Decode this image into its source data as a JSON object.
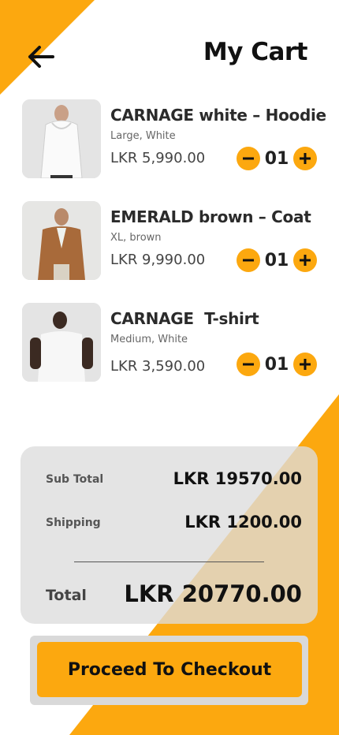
{
  "header": {
    "title": "My Cart",
    "back_icon": "arrow-left-icon"
  },
  "colors": {
    "accent": "#FCA80F",
    "summary_bg": "#DCDCDC",
    "button_frame": "#D9D9D9"
  },
  "cart": {
    "items": [
      {
        "name": "CARNAGE white – Hoodie",
        "variant": "Large, White",
        "price": "LKR 5,990.00",
        "quantity": "01",
        "image": "white hoodie model photo"
      },
      {
        "name": "EMERALD brown – Coat",
        "variant": "XL, brown",
        "price": "LKR 9,990.00",
        "quantity": "01",
        "image": "brown coat model photo"
      },
      {
        "name": "CARNAGE  T-shirt",
        "variant": "Medium, White",
        "price": "LKR 3,590.00",
        "quantity": "01",
        "image": "white t-shirt model photo"
      }
    ]
  },
  "summary": {
    "subtotal_label": "Sub Total",
    "subtotal_value": "LKR 19570.00",
    "shipping_label": "Shipping",
    "shipping_value": "LKR 1200.00",
    "total_label": "Total",
    "total_value": "LKR 20770.00"
  },
  "checkout": {
    "label": "Proceed To Checkout"
  }
}
